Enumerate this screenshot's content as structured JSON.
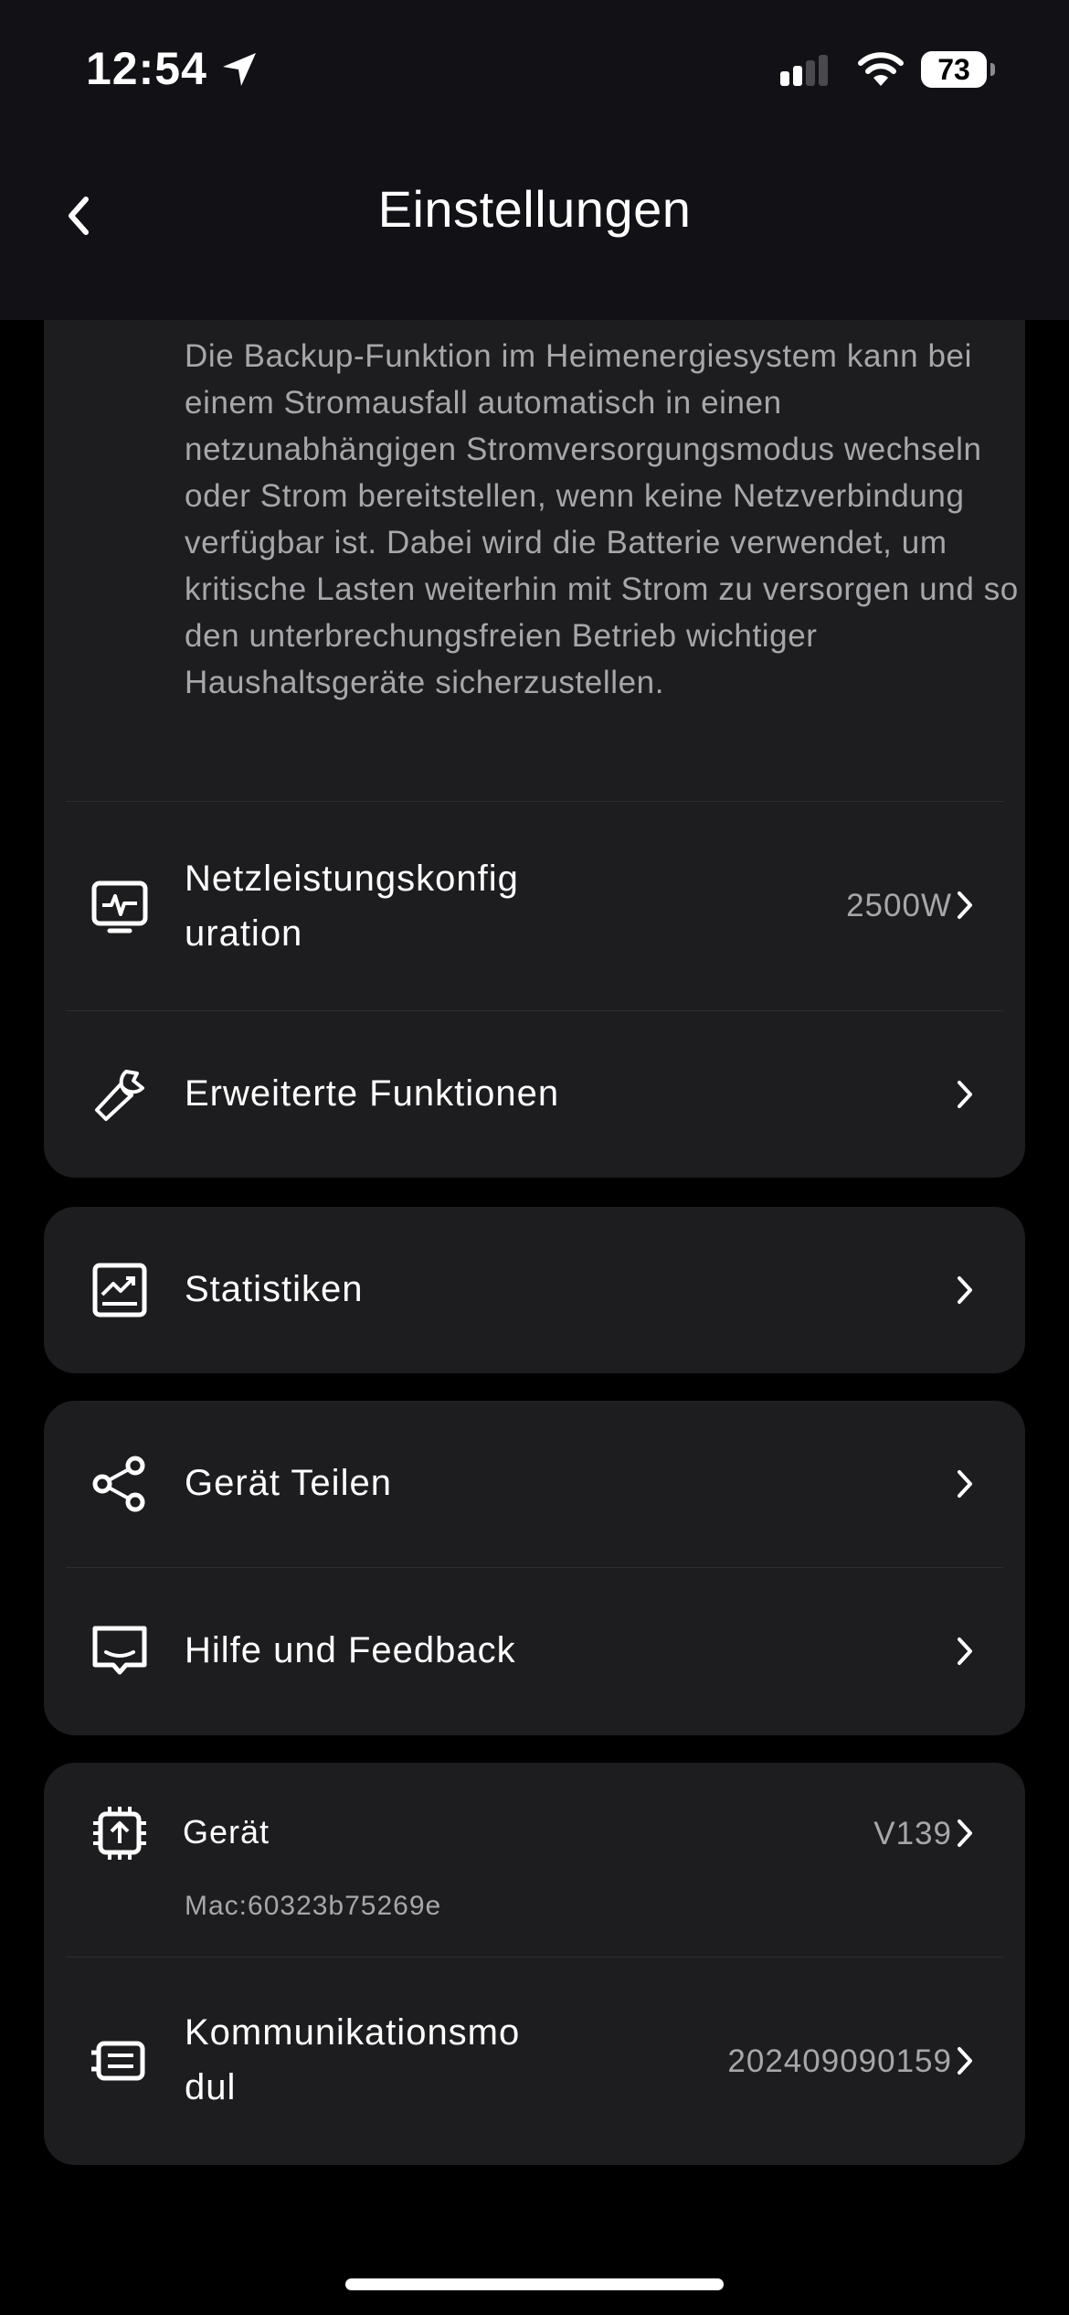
{
  "status": {
    "time": "12:54",
    "battery": "73"
  },
  "header": {
    "title": "Einstellungen"
  },
  "backup": {
    "description": "Die Backup-Funktion im Heimenergiesystem kann bei einem Stromausfall automatisch in einen netzunabhängigen Stromversorgungsmodus wechseln oder Strom bereitstellen, wenn keine Netzverbindung verfügbar ist. Dabei wird die Batterie verwendet, um kritische Lasten weiterhin mit Strom zu versorgen und so den unterbrechungsfreien Betrieb wichtiger Haushaltsgeräte sicherzustellen."
  },
  "items": {
    "grid_power": {
      "label_line1": "Netzleistungskonfig",
      "label_line2": "uration",
      "value": "2500W",
      "icon": "monitor-pulse-icon"
    },
    "advanced": {
      "label": "Erweiterte Funktionen",
      "icon": "wrench-icon"
    },
    "statistics": {
      "label": "Statistiken",
      "icon": "chart-icon"
    },
    "share": {
      "label": "Gerät Teilen",
      "icon": "share-icon"
    },
    "help": {
      "label": "Hilfe und Feedback",
      "icon": "feedback-icon"
    },
    "device": {
      "label": "Gerät",
      "sub": "Mac:60323b75269e",
      "value": "V139",
      "icon": "chip-icon"
    },
    "comm_module": {
      "label_line1": "Kommunikationsmo",
      "label_line2": "dul",
      "value": "202409090159",
      "icon": "module-icon"
    }
  }
}
